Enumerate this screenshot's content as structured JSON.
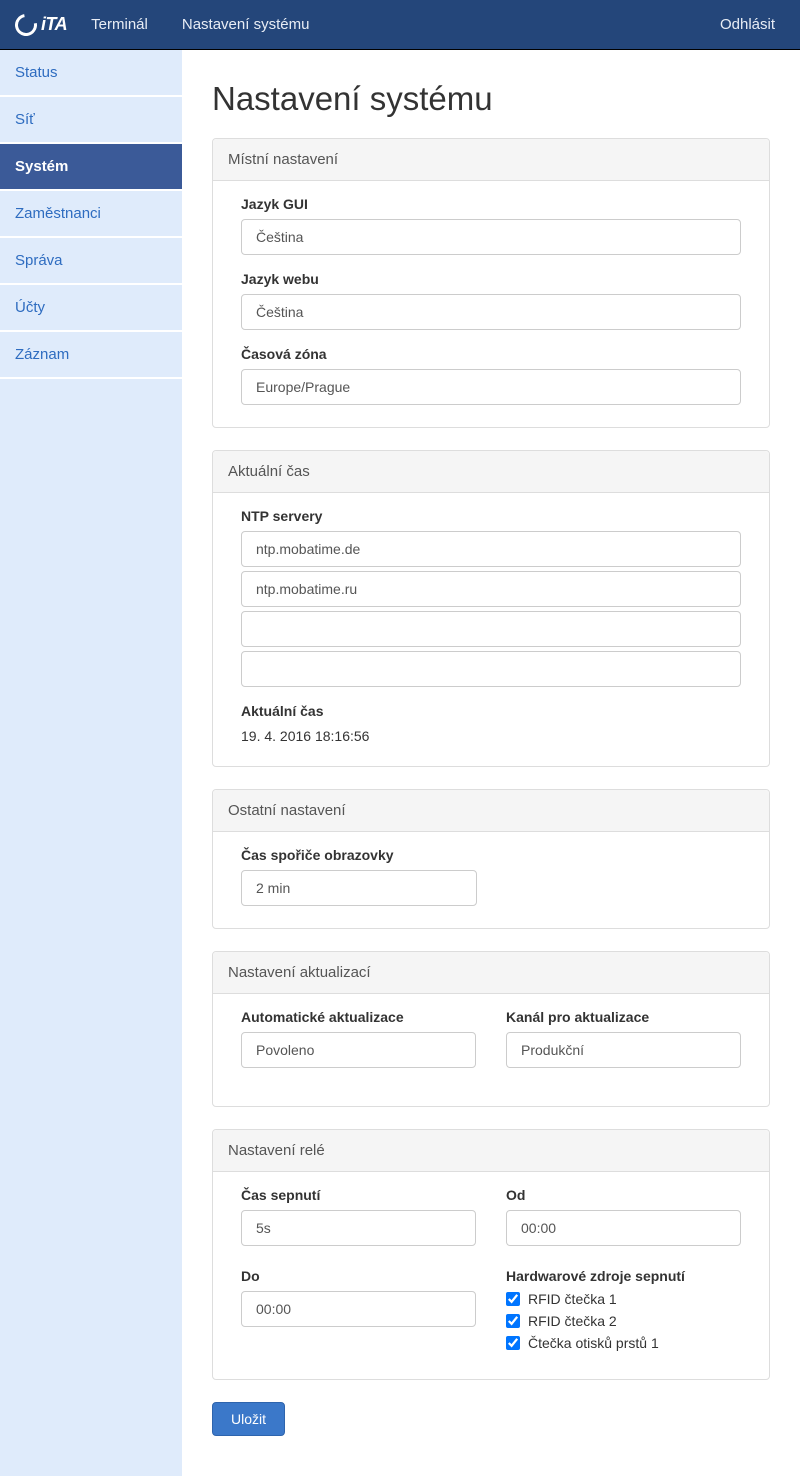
{
  "navbar": {
    "brand": "iTA",
    "links": [
      "Terminál",
      "Nastavení systému"
    ],
    "logout": "Odhlásit"
  },
  "sidebar": {
    "items": [
      {
        "label": "Status",
        "active": false
      },
      {
        "label": "Síť",
        "active": false
      },
      {
        "label": "Systém",
        "active": true
      },
      {
        "label": "Zaměstnanci",
        "active": false
      },
      {
        "label": "Správa",
        "active": false
      },
      {
        "label": "Účty",
        "active": false
      },
      {
        "label": "Záznam",
        "active": false
      }
    ]
  },
  "page": {
    "title": "Nastavení systému"
  },
  "local": {
    "heading": "Místní nastavení",
    "gui_label": "Jazyk GUI",
    "gui_value": "Čeština",
    "web_label": "Jazyk webu",
    "web_value": "Čeština",
    "tz_label": "Časová zóna",
    "tz_value": "Europe/Prague"
  },
  "time": {
    "heading": "Aktuální čas",
    "ntp_label": "NTP servery",
    "ntp": [
      "ntp.mobatime.de",
      "ntp.mobatime.ru",
      "",
      ""
    ],
    "current_label": "Aktuální čas",
    "current_value": "19. 4. 2016 18:16:56"
  },
  "other": {
    "heading": "Ostatní nastavení",
    "screensaver_label": "Čas spořiče obrazovky",
    "screensaver_value": "2 min"
  },
  "updates": {
    "heading": "Nastavení aktualizací",
    "auto_label": "Automatické aktualizace",
    "auto_value": "Povoleno",
    "channel_label": "Kanál pro aktualizace",
    "channel_value": "Produkční"
  },
  "relay": {
    "heading": "Nastavení relé",
    "switch_time_label": "Čas sepnutí",
    "switch_time_value": "5s",
    "from_label": "Od",
    "from_value": "00:00",
    "to_label": "Do",
    "to_value": "00:00",
    "hw_label": "Hardwarové zdroje sepnutí",
    "hw_sources": [
      {
        "label": "RFID čtečka 1",
        "checked": true
      },
      {
        "label": "RFID čtečka 2",
        "checked": true
      },
      {
        "label": "Čtečka otisků prstů 1",
        "checked": true
      }
    ]
  },
  "actions": {
    "save": "Uložit"
  }
}
